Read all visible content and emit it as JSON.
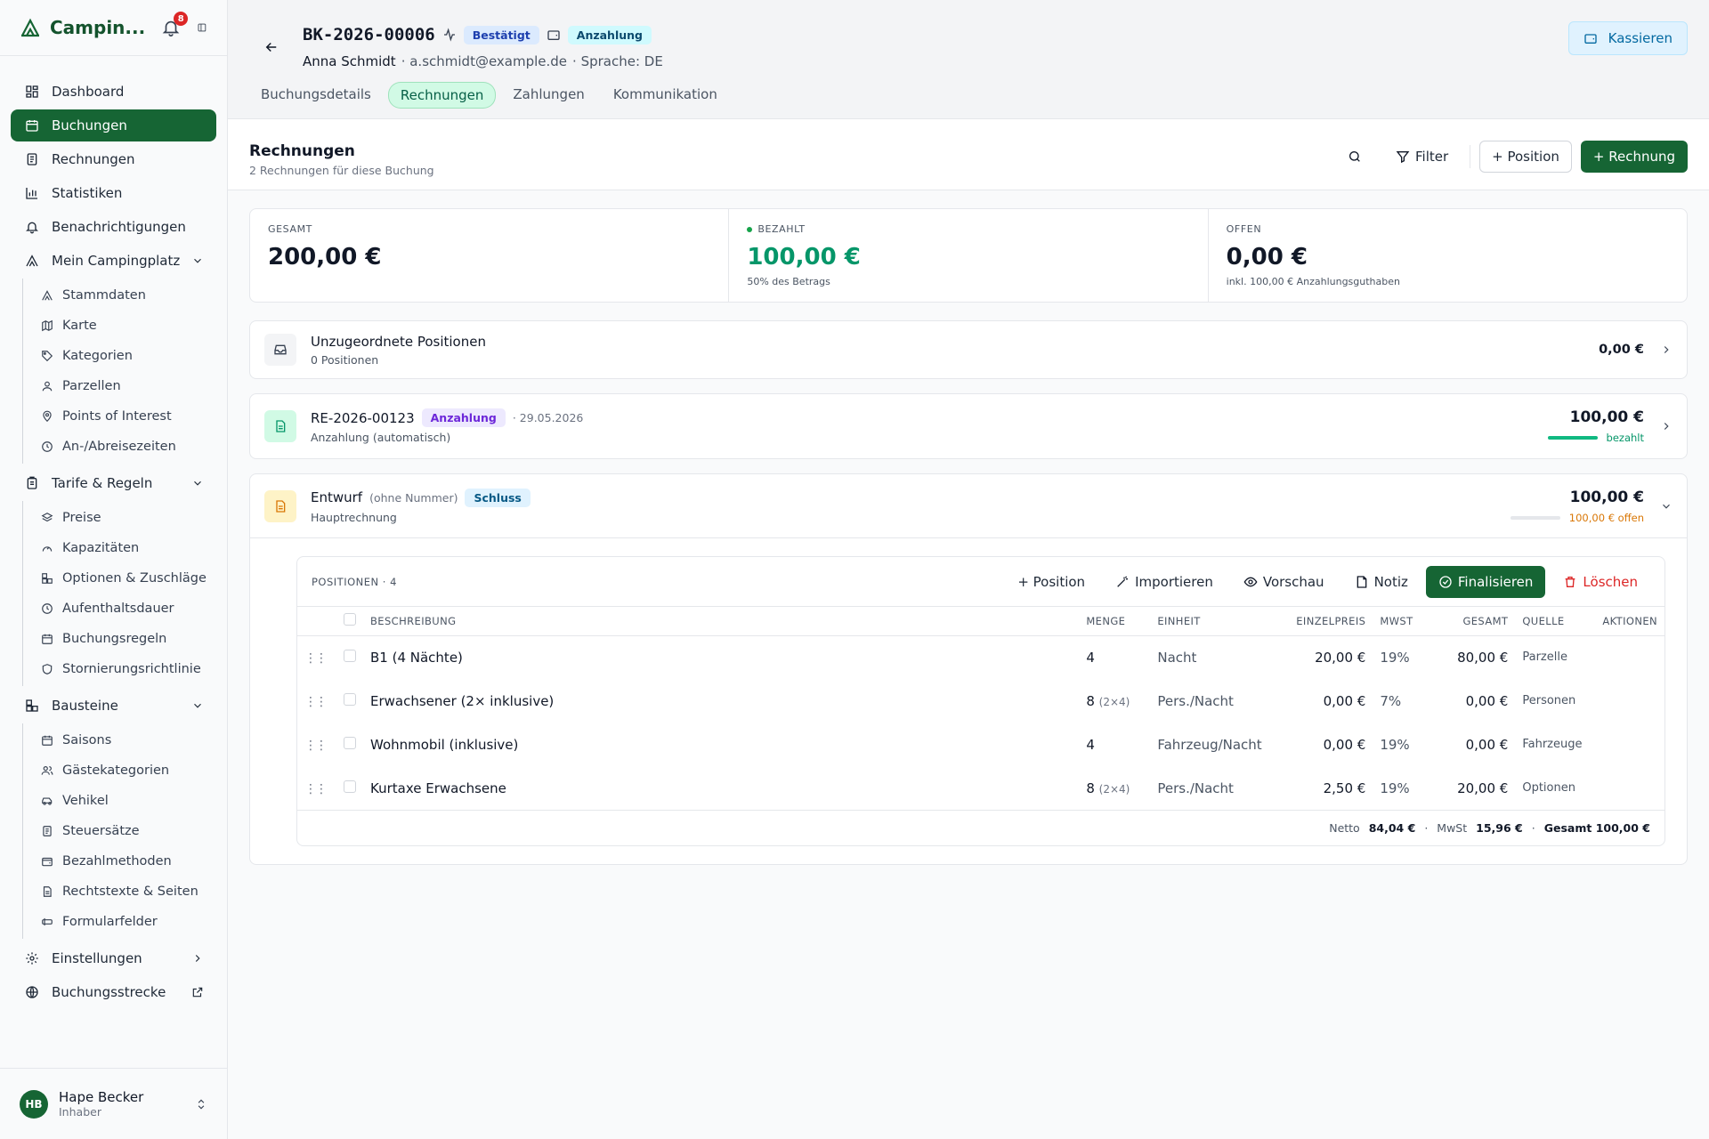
{
  "app": {
    "brand": "Campin...",
    "notification_count": "8"
  },
  "sidebar": {
    "items": [
      {
        "label": "Dashboard",
        "icon": "dashboard-icon"
      },
      {
        "label": "Buchungen",
        "icon": "calendar-icon"
      },
      {
        "label": "Rechnungen",
        "icon": "invoice-icon"
      },
      {
        "label": "Statistiken",
        "icon": "chart-icon"
      },
      {
        "label": "Benachrichtigungen",
        "icon": "bell-icon"
      }
    ],
    "groups": [
      {
        "label": "Mein Campingplatz",
        "items": [
          "Stammdaten",
          "Karte",
          "Kategorien",
          "Parzellen",
          "Points of Interest",
          "An-/Abreisezeiten"
        ]
      },
      {
        "label": "Tarife & Regeln",
        "items": [
          "Preise",
          "Kapazitäten",
          "Optionen & Zuschläge",
          "Aufenthaltsdauer",
          "Buchungsregeln",
          "Stornierungsrichtlinie"
        ]
      },
      {
        "label": "Bausteine",
        "items": [
          "Saisons",
          "Gästekategorien",
          "Vehikel",
          "Steuersätze",
          "Bezahlmethoden",
          "Rechtstexte & Seiten",
          "Formularfelder"
        ]
      }
    ],
    "settings": "Einstellungen",
    "booking_flow": "Buchungsstrecke",
    "user": {
      "initials": "HB",
      "name": "Hape Becker",
      "role": "Inhaber"
    }
  },
  "header": {
    "booking_id": "BK-2026-00006",
    "status": "Bestätigt",
    "payment_status": "Anzahlung",
    "customer": "Anna Schmidt",
    "email": "· a.schmidt@example.de",
    "language": "· Sprache: DE",
    "cash_button": "Kassieren",
    "tabs": [
      "Buchungsdetails",
      "Rechnungen",
      "Zahlungen",
      "Kommunikation"
    ]
  },
  "section": {
    "title": "Rechnungen",
    "subtitle": "2 Rechnungen für diese Buchung",
    "filter": "Filter",
    "add_position": "+ Position",
    "add_invoice": "+ Rechnung"
  },
  "stats": {
    "total_label": "GESAMT",
    "total_value": "200,00 €",
    "paid_label": "BEZAHLT",
    "paid_value": "100,00 €",
    "paid_note": "50% des Betrags",
    "open_label": "OFFEN",
    "open_value": "0,00 €",
    "open_note": "inkl. 100,00 € Anzahlungsguthaben"
  },
  "unassigned": {
    "title": "Unzugeordnete Positionen",
    "subtitle": "0 Positionen",
    "amount": "0,00 €"
  },
  "invoice1": {
    "number": "RE-2026-00123",
    "badge": "Anzahlung",
    "date": "· 29.05.2026",
    "subtitle": "Anzahlung (automatisch)",
    "amount": "100,00 €",
    "progress_label": "bezahlt",
    "progress": 1.0
  },
  "invoice2": {
    "title": "Entwurf",
    "number_note": "(ohne Nummer)",
    "badge": "Schluss",
    "subtitle": "Hauptrechnung",
    "amount": "100,00 €",
    "progress_label": "100,00 € offen",
    "progress": 0.0
  },
  "positions": {
    "label": "POSITIONEN · 4",
    "actions": {
      "add": "+ Position",
      "import": "Importieren",
      "preview": "Vorschau",
      "note": "Notiz",
      "finalize": "Finalisieren",
      "delete": "Löschen"
    },
    "columns": [
      "BESCHREIBUNG",
      "MENGE",
      "EINHEIT",
      "EINZELPREIS",
      "MWST",
      "GESAMT",
      "QUELLE",
      "AKTIONEN"
    ],
    "rows": [
      {
        "desc": "B1 (4 Nächte)",
        "qty": "4",
        "qty_note": "",
        "unit": "Nacht",
        "price": "20,00 €",
        "vat": "19%",
        "total": "80,00 €",
        "source": "Parzelle"
      },
      {
        "desc": "Erwachsener (2× inklusive)",
        "qty": "8",
        "qty_note": "(2×4)",
        "unit": "Pers./Nacht",
        "price": "0,00 €",
        "vat": "7%",
        "total": "0,00 €",
        "source": "Personen"
      },
      {
        "desc": "Wohnmobil (inklusive)",
        "qty": "4",
        "qty_note": "",
        "unit": "Fahrzeug/Nacht",
        "price": "0,00 €",
        "vat": "19%",
        "total": "0,00 €",
        "source": "Fahrzeuge"
      },
      {
        "desc": "Kurtaxe Erwachsene",
        "qty": "8",
        "qty_note": "(2×4)",
        "unit": "Pers./Nacht",
        "price": "2,50 €",
        "vat": "19%",
        "total": "20,00 €",
        "source": "Optionen"
      }
    ],
    "totals": {
      "net_label": "Netto",
      "net": "84,04 €",
      "vat_label": "MwSt",
      "vat": "15,96 €",
      "total": "Gesamt 100,00 €"
    }
  },
  "colors": {
    "primary": "#166534",
    "paid": "#059669",
    "open": "#d97706"
  }
}
